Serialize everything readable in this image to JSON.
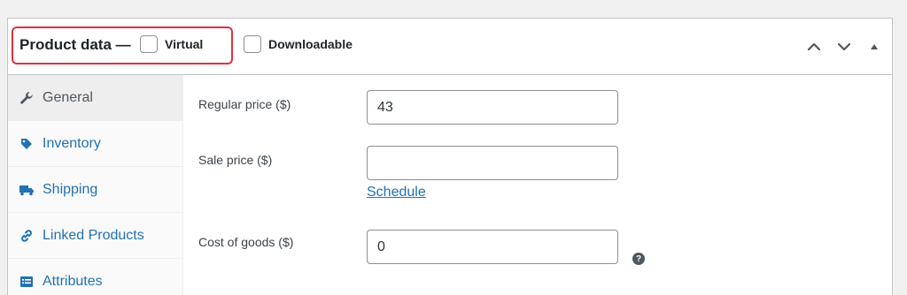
{
  "header": {
    "title": "Product data —",
    "virtual_label": "Virtual",
    "downloadable_label": "Downloadable",
    "controls": [
      "chevron-up-icon",
      "chevron-down-icon",
      "caret-up-icon"
    ]
  },
  "sidebar": {
    "items": [
      {
        "label": "General",
        "icon": "wrench-icon",
        "active": true
      },
      {
        "label": "Inventory",
        "icon": "tag-icon",
        "active": false
      },
      {
        "label": "Shipping",
        "icon": "truck-icon",
        "active": false
      },
      {
        "label": "Linked Products",
        "icon": "link-icon",
        "active": false
      },
      {
        "label": "Attributes",
        "icon": "list-icon",
        "active": false
      }
    ]
  },
  "main": {
    "regular_price_label": "Regular price ($)",
    "regular_price_value": "43",
    "sale_price_label": "Sale price ($)",
    "sale_price_value": "",
    "schedule_label": "Schedule",
    "cost_of_goods_label": "Cost of goods ($)",
    "cost_of_goods_value": "0",
    "help_icon": "?"
  },
  "colors": {
    "link": "#2271b1",
    "highlight": "#e0303f",
    "border": "#c3c4c7",
    "background": "#f0f0f1"
  }
}
